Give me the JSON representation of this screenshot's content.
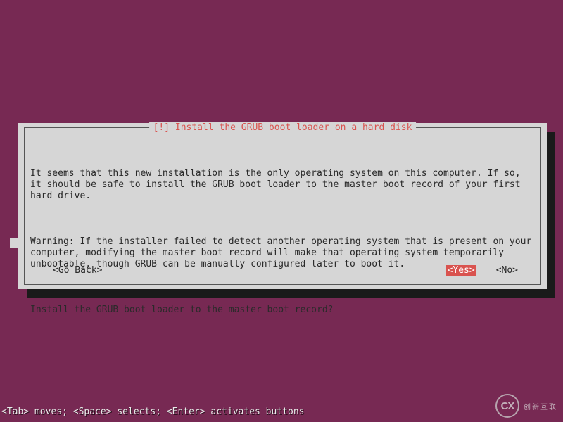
{
  "dialog": {
    "title": "[!] Install the GRUB boot loader on a hard disk",
    "paragraph1": "It seems that this new installation is the only operating system on this computer. If so, it should be safe to install the GRUB boot loader to the master boot record of your first hard drive.",
    "paragraph2": "Warning: If the installer failed to detect another operating system that is present on your computer, modifying the master boot record will make that operating system temporarily unbootable, though GRUB can be manually configured later to boot it.",
    "question": "Install the GRUB boot loader to the master boot record?",
    "buttons": {
      "back": "<Go Back>",
      "yes": "<Yes>",
      "no": "<No>"
    }
  },
  "helpbar": "<Tab> moves; <Space> selects; <Enter> activates buttons",
  "watermark": {
    "logo": "CX",
    "text": "创新互联"
  },
  "colors": {
    "background": "#772953",
    "dialog_bg": "#d6d6d6",
    "accent_red": "#d9534f"
  }
}
